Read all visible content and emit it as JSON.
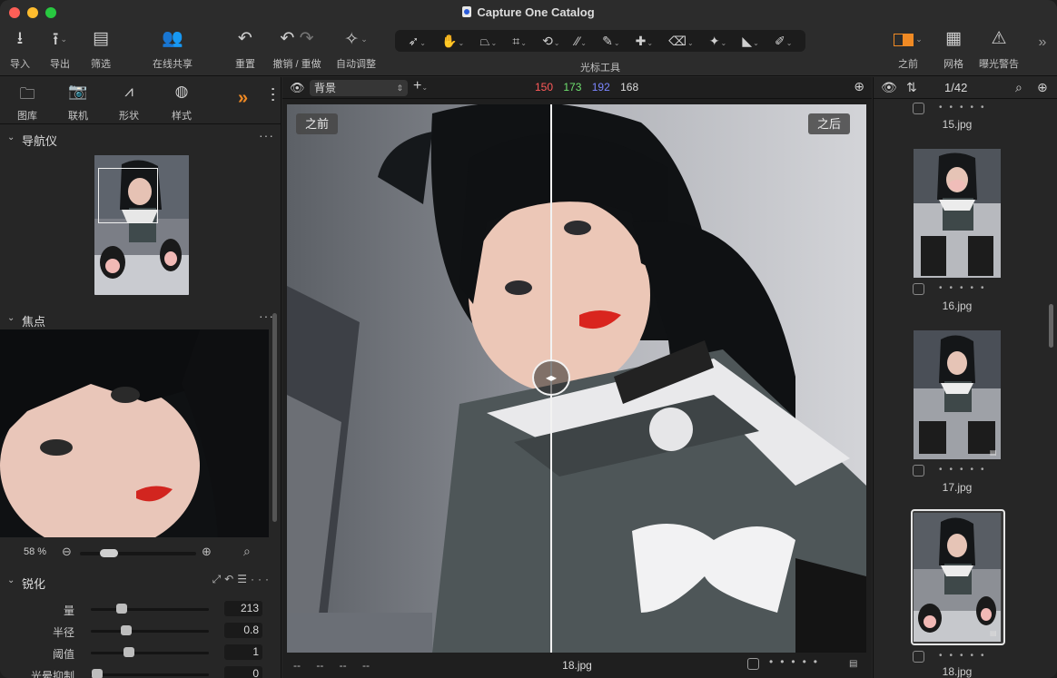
{
  "window": {
    "title": "Capture One Catalog"
  },
  "toolbar": {
    "import": "导入",
    "export": "导出",
    "filter": "筛选",
    "share": "在线共享",
    "reset": "重置",
    "undo_redo": "撤销 / 重做",
    "auto_adjust": "自动调整",
    "cursor_tools": "光标工具",
    "before": "之前",
    "grid": "网格",
    "exposure_warning": "曝光警告"
  },
  "tool_tabs": [
    "图库",
    "联机",
    "形状",
    "样式"
  ],
  "navigator": {
    "title": "导航仪"
  },
  "focus": {
    "title": "焦点",
    "zoom": "58 %"
  },
  "sharpen": {
    "title": "锐化",
    "rows": [
      {
        "label": "量",
        "value": "213",
        "level": 0.26
      },
      {
        "label": "半径",
        "value": "0.8",
        "level": 0.3
      },
      {
        "label": "阈值",
        "value": "1",
        "level": 0.32
      },
      {
        "label": "光晕抑制",
        "value": "0",
        "level": 0.05
      }
    ]
  },
  "viewer": {
    "layer": "背景",
    "rgb": {
      "r": "150",
      "g": "173",
      "b": "192",
      "l": "168"
    },
    "before_badge": "之前",
    "after_badge": "之后",
    "filename": "18.jpg",
    "footer_dashes": "-- -- -- --"
  },
  "browser": {
    "counter": "1/42",
    "items": [
      {
        "name": "15.jpg"
      },
      {
        "name": "16.jpg"
      },
      {
        "name": "17.jpg"
      },
      {
        "name": "18.jpg",
        "selected": true
      }
    ]
  },
  "colors": {
    "accent": "#f08a24",
    "r": "#ff5a5a",
    "g": "#6fe06f",
    "b": "#7b86ff"
  }
}
